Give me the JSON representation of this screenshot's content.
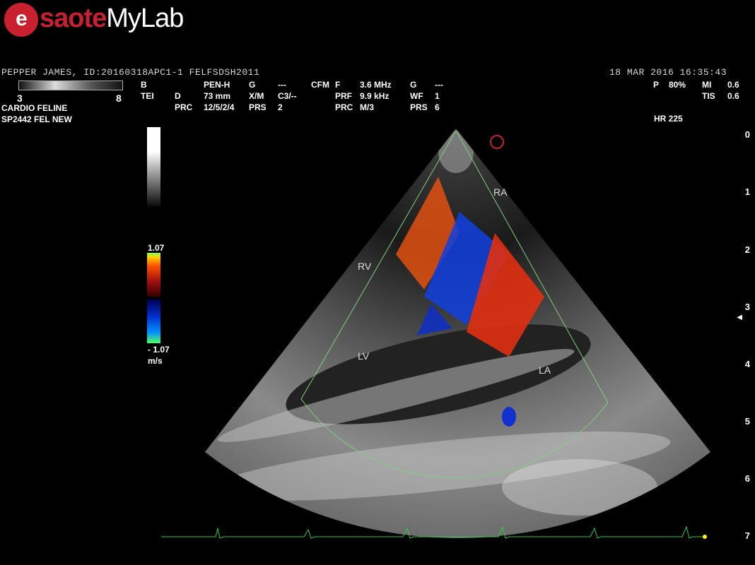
{
  "brand": {
    "esaote": "saote",
    "mylab": "MyLab",
    "e_glyph": "e"
  },
  "patient": {
    "line": "PEPPER JAMES, ID:20160318APC1-1  FELFSDSH2011",
    "datetime": "18  MAR  2016 16:35:43"
  },
  "gain_scale": {
    "min": "3",
    "max": "8"
  },
  "preset": {
    "line1": "CARDIO FELINE",
    "line2": "SP2442  FEL NEW"
  },
  "params": {
    "b": "B",
    "tei": "TEI",
    "pen": "PEN-H",
    "d_label": "D",
    "d_val": "73 mm",
    "prc_label": "PRC",
    "prc_val": "12/5/2/4",
    "g_label": "G",
    "g_val": "---",
    "xm_label": "X/M",
    "xm_val": "C3/--",
    "prs_label": "PRS",
    "prs_val": "2",
    "cfm": "CFM",
    "f_label": "F",
    "f_val": "3.6 MHz",
    "prf_label": "PRF",
    "prf_val": "9.9 kHz",
    "prc2_label": "PRC",
    "prc2_val": "M/3",
    "g2_label": "G",
    "g2_val": "---",
    "wf_label": "WF",
    "wf_val": "1",
    "prs2_label": "PRS",
    "prs2_val": "6"
  },
  "power": {
    "p_label": "P",
    "p_val": "80%",
    "mi_label": "MI",
    "mi_val": "0.6",
    "tis_label": "TIS",
    "tis_val": "0.6",
    "hr": "HR 225"
  },
  "velocity_scale": {
    "max": "1.07",
    "min": "- 1.07",
    "unit": "m/s"
  },
  "depth_scale": [
    "0",
    "1",
    "2",
    "3",
    "4",
    "5",
    "6",
    "7"
  ],
  "anatomy": {
    "ra": "RA",
    "rv": "RV",
    "lv": "LV",
    "la": "LA"
  },
  "colors": {
    "brand": "#c8202f",
    "ecg": "#2ecc40",
    "roi": "#7fd07f",
    "ecg_marker": "#ffff00"
  }
}
